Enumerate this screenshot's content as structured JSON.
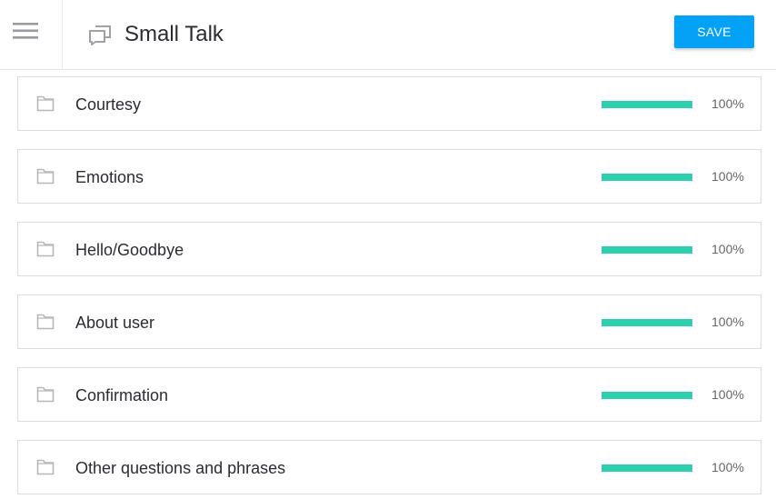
{
  "header": {
    "title": "Small Talk",
    "save_label": "SAVE",
    "menu_icon": "hamburger-menu-icon",
    "title_icon": "chat-bubbles-icon"
  },
  "colors": {
    "accent": "#03a2f7",
    "progress": "#2ccfae",
    "folder_icon": "#b7b7bf"
  },
  "categories": [
    {
      "label": "Courtesy",
      "progress_percent": 100,
      "progress_text": "100%"
    },
    {
      "label": "Emotions",
      "progress_percent": 100,
      "progress_text": "100%"
    },
    {
      "label": "Hello/Goodbye",
      "progress_percent": 100,
      "progress_text": "100%"
    },
    {
      "label": "About user",
      "progress_percent": 100,
      "progress_text": "100%"
    },
    {
      "label": "Confirmation",
      "progress_percent": 100,
      "progress_text": "100%"
    },
    {
      "label": "Other questions and phrases",
      "progress_percent": 100,
      "progress_text": "100%"
    }
  ]
}
